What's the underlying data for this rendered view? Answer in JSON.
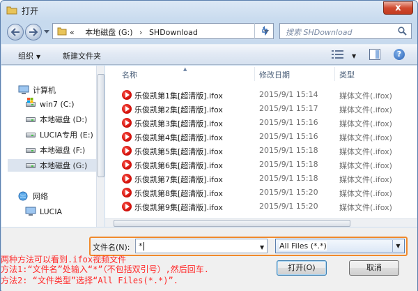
{
  "window": {
    "title": "打开",
    "close_glyph": "x"
  },
  "address": {
    "chevron": "«",
    "crumbs": [
      "本地磁盘 (G:)",
      "SHDownload"
    ],
    "sep": "›"
  },
  "search": {
    "placeholder": "搜索 SHDownload"
  },
  "toolbar": {
    "organize": "组织",
    "new_folder": "新建文件夹",
    "help": "?"
  },
  "nav": {
    "computer": "计算机",
    "drives": [
      "win7 (C:)",
      "本地磁盘 (D:)",
      "LUCIA专用 (E:)",
      "本地磁盘 (F:)",
      "本地磁盘 (G:)"
    ],
    "network": "网络",
    "net_items": [
      "LUCIA"
    ]
  },
  "columns": {
    "name": "名称",
    "date": "修改日期",
    "type": "类型"
  },
  "files": [
    {
      "name": "乐俊凯第1集[超清版].ifox",
      "date": "2015/9/1 15:14",
      "type": "媒体文件(.ifox)"
    },
    {
      "name": "乐俊凯第2集[超清版].ifox",
      "date": "2015/9/1 15:17",
      "type": "媒体文件(.ifox)"
    },
    {
      "name": "乐俊凯第3集[超清版].ifox",
      "date": "2015/9/1 15:16",
      "type": "媒体文件(.ifox)"
    },
    {
      "name": "乐俊凯第4集[超清版].ifox",
      "date": "2015/9/1 15:16",
      "type": "媒体文件(.ifox)"
    },
    {
      "name": "乐俊凯第5集[超清版].ifox",
      "date": "2015/9/1 15:18",
      "type": "媒体文件(.ifox)"
    },
    {
      "name": "乐俊凯第6集[超清版].ifox",
      "date": "2015/9/1 15:18",
      "type": "媒体文件(.ifox)"
    },
    {
      "name": "乐俊凯第7集[超清版].ifox",
      "date": "2015/9/1 15:18",
      "type": "媒体文件(.ifox)"
    },
    {
      "name": "乐俊凯第8集[超清版].ifox",
      "date": "2015/9/1 15:20",
      "type": "媒体文件(.ifox)"
    },
    {
      "name": "乐俊凯第9集[超清版].ifox",
      "date": "2015/9/1 15:20",
      "type": "媒体文件(.ifox)"
    }
  ],
  "filename": {
    "label": "文件名(N):",
    "value": "*"
  },
  "filetype": {
    "selected": "All Files (*.*)"
  },
  "buttons": {
    "open": "打开(O)",
    "cancel": "取消"
  },
  "notes": [
    "两种方法可以看到.ifox视频文件",
    "方法1:“文件名”处输入“*”（不包括双引号）,然后回车.",
    "方法2: “文件类型”选择“All Files(*.*)”."
  ],
  "colors": {
    "note": "#ff2a2a",
    "focus_box": "#f08a2c",
    "file_icon": "#d4110b"
  }
}
